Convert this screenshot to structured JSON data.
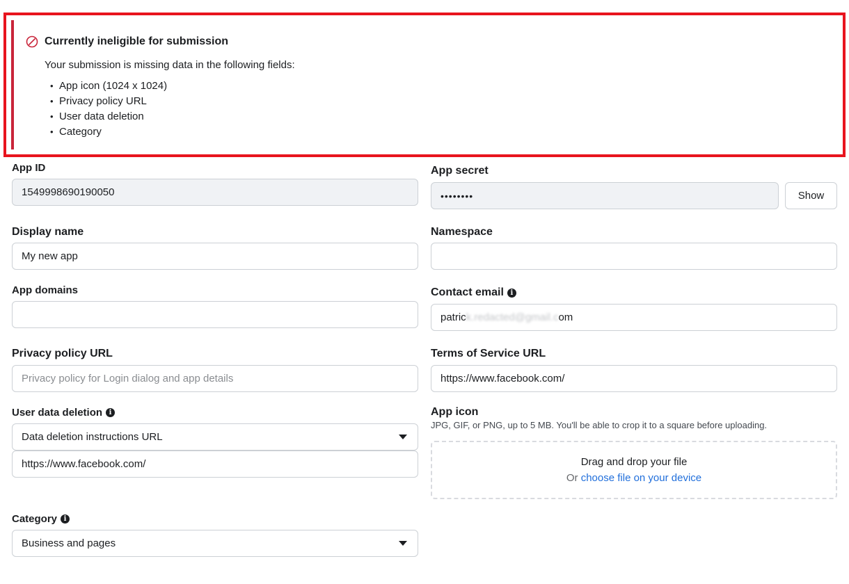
{
  "alert": {
    "icon": "prohibited-icon",
    "title": "Currently ineligible for submission",
    "subtitle": "Your submission is missing data in the following fields:",
    "missing_fields": [
      "App icon (1024 x 1024)",
      "Privacy policy URL",
      "User data deletion",
      "Category"
    ],
    "bullet": "•",
    "accent_color": "#c9253a",
    "highlight_color": "#e8141e"
  },
  "app_id": {
    "label": "App ID",
    "value": "1549998690190050"
  },
  "app_secret": {
    "label": "App secret",
    "value": "••••••••",
    "button": "Show"
  },
  "display_name": {
    "label": "Display name",
    "value": "My new app"
  },
  "namespace": {
    "label": "Namespace",
    "value": ""
  },
  "app_domains": {
    "label": "App domains",
    "value": ""
  },
  "contact_email": {
    "label": "Contact email",
    "value_visible_start": "patric",
    "value_blurred": "k.redacted@gmail.c",
    "value_visible_end": "om",
    "info_icon": "info-icon"
  },
  "privacy_policy": {
    "label": "Privacy policy URL",
    "placeholder": "Privacy policy for Login dialog and app details"
  },
  "terms_of_service": {
    "label": "Terms of Service URL",
    "value": "https://www.facebook.com/"
  },
  "user_data_deletion": {
    "label": "User data deletion",
    "selected": "Data deletion instructions URL",
    "url": "https://www.facebook.com/",
    "info_icon": "info-icon"
  },
  "app_icon": {
    "label": "App icon",
    "hint": "JPG, GIF, or PNG, up to 5 MB. You'll be able to crop it to a square before uploading.",
    "drop_title": "Drag and drop your file",
    "drop_or": "Or",
    "drop_link": "choose file on your device",
    "link_color": "#216fdb"
  },
  "category": {
    "label": "Category",
    "selected": "Business and pages",
    "info_icon": "info-icon"
  }
}
